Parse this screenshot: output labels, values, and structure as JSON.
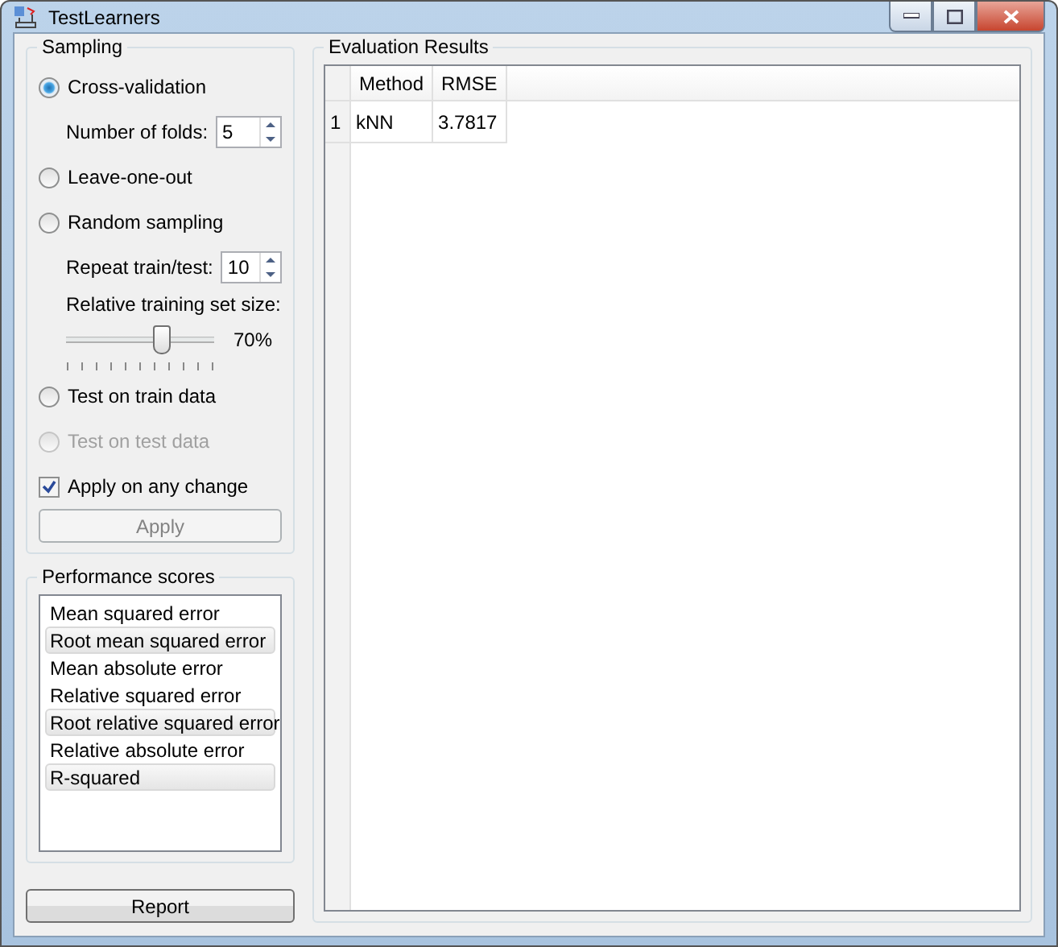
{
  "window": {
    "title": "TestLearners"
  },
  "sampling": {
    "title": "Sampling",
    "options": [
      {
        "kind": "radio",
        "label": "Cross-validation",
        "selected": true,
        "disabled": false
      },
      {
        "kind": "spin",
        "label": "Number of folds:",
        "value": "5"
      },
      {
        "kind": "radio",
        "label": "Leave-one-out",
        "selected": false,
        "disabled": false
      },
      {
        "kind": "radio",
        "label": "Random sampling",
        "selected": false,
        "disabled": false
      },
      {
        "kind": "spin",
        "label": "Repeat train/test:",
        "value": "10"
      },
      {
        "kind": "slider",
        "label": "Relative training set size:",
        "level": 0.64,
        "reading": "70%"
      },
      {
        "kind": "radio",
        "label": "Test on train data",
        "selected": false,
        "disabled": false
      },
      {
        "kind": "radio",
        "label": "Test on test data",
        "selected": false,
        "disabled": true
      }
    ],
    "apply_on_change": {
      "label": "Apply on any change",
      "checked": true
    },
    "apply_button": {
      "label": "Apply",
      "disabled": true
    }
  },
  "performance": {
    "title": "Performance scores",
    "items": [
      {
        "label": "Mean squared error",
        "selected": false
      },
      {
        "label": "Root mean squared error",
        "selected": true
      },
      {
        "label": "Mean absolute error",
        "selected": false
      },
      {
        "label": "Relative squared error",
        "selected": false
      },
      {
        "label": "Root relative squared error",
        "selected": true
      },
      {
        "label": "Relative absolute error",
        "selected": false
      },
      {
        "label": "R-squared",
        "selected": true
      }
    ]
  },
  "report_button": {
    "label": "Report"
  },
  "results": {
    "title": "Evaluation Results",
    "columns": [
      "Method",
      "RMSE"
    ],
    "rows": [
      {
        "index": "1",
        "cells": [
          "kNN",
          "3.7817"
        ]
      }
    ]
  }
}
